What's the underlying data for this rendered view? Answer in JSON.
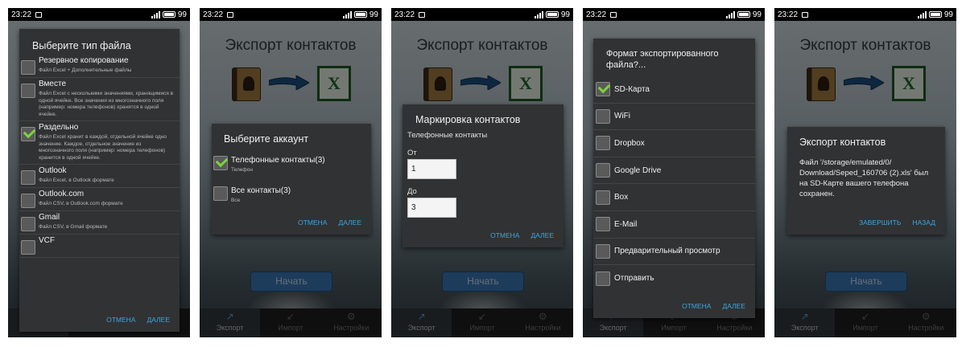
{
  "status_bar": {
    "time": "23:22",
    "battery": "99"
  },
  "app": {
    "title": "Экспорт контактов",
    "start_button": "Начать",
    "tabs": [
      "Экспорт",
      "Импорт",
      "Настройки"
    ]
  },
  "accent_color": "#3aa6e2",
  "screen1": {
    "dialog_title": "Выберите тип файла",
    "items": [
      {
        "name": "Резервное копирование",
        "desc": "Файл Excel + Дополнительные файлы",
        "checked": false
      },
      {
        "name": "Вместе",
        "desc": "Файл Excel с несколькими значениями, хранящимися в одной ячейке. Все значения из многозначного поля (например: номера телефонов) хранятся в одной ячейке.",
        "checked": false
      },
      {
        "name": "Раздельно",
        "desc": "Файл Excel хранит в каждой, отдельной ячейке одно значение. Каждое, отдельное значение из многозначного поля (например: номера телефонов) хранится в одной ячейке.",
        "checked": true
      },
      {
        "name": "Outlook",
        "desc": "Файл Excel, в Outlook формате",
        "checked": false
      },
      {
        "name": "Outlook.com",
        "desc": "Файл CSV, в Outlook.com формате",
        "checked": false
      },
      {
        "name": "Gmail",
        "desc": "Файл CSV, в Gmail формате",
        "checked": false
      },
      {
        "name": "VCF",
        "desc": "",
        "checked": false
      }
    ],
    "cancel": "ОТМЕНА",
    "next": "ДАЛЕЕ"
  },
  "screen2": {
    "dialog_title": "Выберите аккаунт",
    "accounts": [
      {
        "name": "Телефонные контакты(3)",
        "sub": "Телефон",
        "checked": true
      },
      {
        "name": "Все контакты(3)",
        "sub": "Все",
        "checked": false
      }
    ],
    "cancel": "ОТМЕНА",
    "next": "ДАЛЕЕ"
  },
  "screen3": {
    "dialog_title": "Маркировка контактов",
    "subtitle": "Телефонные контакты",
    "from_label": "От",
    "from_value": "1",
    "to_label": "До",
    "to_value": "3",
    "cancel": "ОТМЕНА",
    "next": "ДАЛЕЕ"
  },
  "screen4": {
    "dialog_title_line1": "Формат экспортированного",
    "dialog_title_line2": "файла?...",
    "destinations": [
      {
        "label": "SD-Карта",
        "checked": true
      },
      {
        "label": "WiFi",
        "checked": false
      },
      {
        "label": "Dropbox",
        "checked": false
      },
      {
        "label": "Google Drive",
        "checked": false
      },
      {
        "label": "Box",
        "checked": false
      },
      {
        "label": "E-Mail",
        "checked": false
      },
      {
        "label": "Предварительный просмотр",
        "checked": false
      },
      {
        "label": "Отправить",
        "checked": false
      }
    ],
    "cancel": "ОТМЕНА",
    "next": "ДАЛЕЕ"
  },
  "screen5": {
    "dialog_title": "Экспорт контактов",
    "message": "Файл '/storage/emulated/0/ Download/Seped_160706 (2).xls' был на SD-Карте вашего телефона сохранен.",
    "finish": "ЗАВЕРШИТЬ",
    "back": "НАЗАД"
  }
}
